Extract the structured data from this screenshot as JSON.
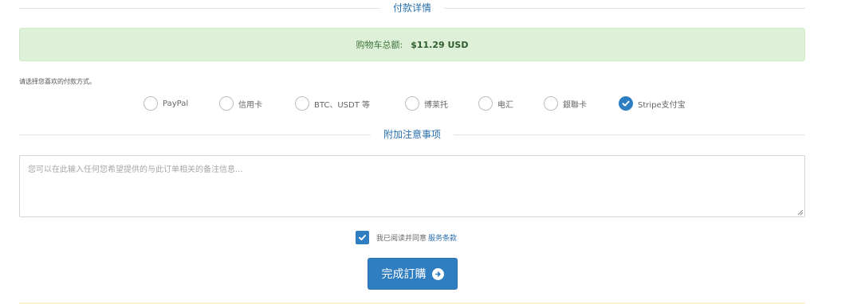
{
  "payment_details": {
    "title": "付款详情",
    "cart_total_label": "购物车总额:",
    "cart_total_amount": "$11.29 USD"
  },
  "payment_method": {
    "prompt": "请选择您喜欢的付款方式。",
    "options": [
      {
        "label": "PayPal",
        "selected": false
      },
      {
        "label": "信用卡",
        "selected": false
      },
      {
        "label": "BTC、USDT 等",
        "selected": false
      },
      {
        "label": "博莱托",
        "selected": false
      },
      {
        "label": "电汇",
        "selected": false
      },
      {
        "label": "銀聯卡",
        "selected": false
      },
      {
        "label": "Stripe支付宝",
        "selected": true
      }
    ]
  },
  "notes": {
    "title": "附加注意事项",
    "placeholder": "您可以在此输入任何您希望提供的与此订单相关的备注信息..."
  },
  "terms": {
    "checked": true,
    "text": "我已阅读并同意",
    "link_text": "服务条款"
  },
  "submit": {
    "label": "完成訂購",
    "icon": "arrow-circle-right-icon"
  },
  "colors": {
    "accent": "#2f7ec2",
    "success_bg": "#dff0d8",
    "success_text": "#3c763d"
  }
}
